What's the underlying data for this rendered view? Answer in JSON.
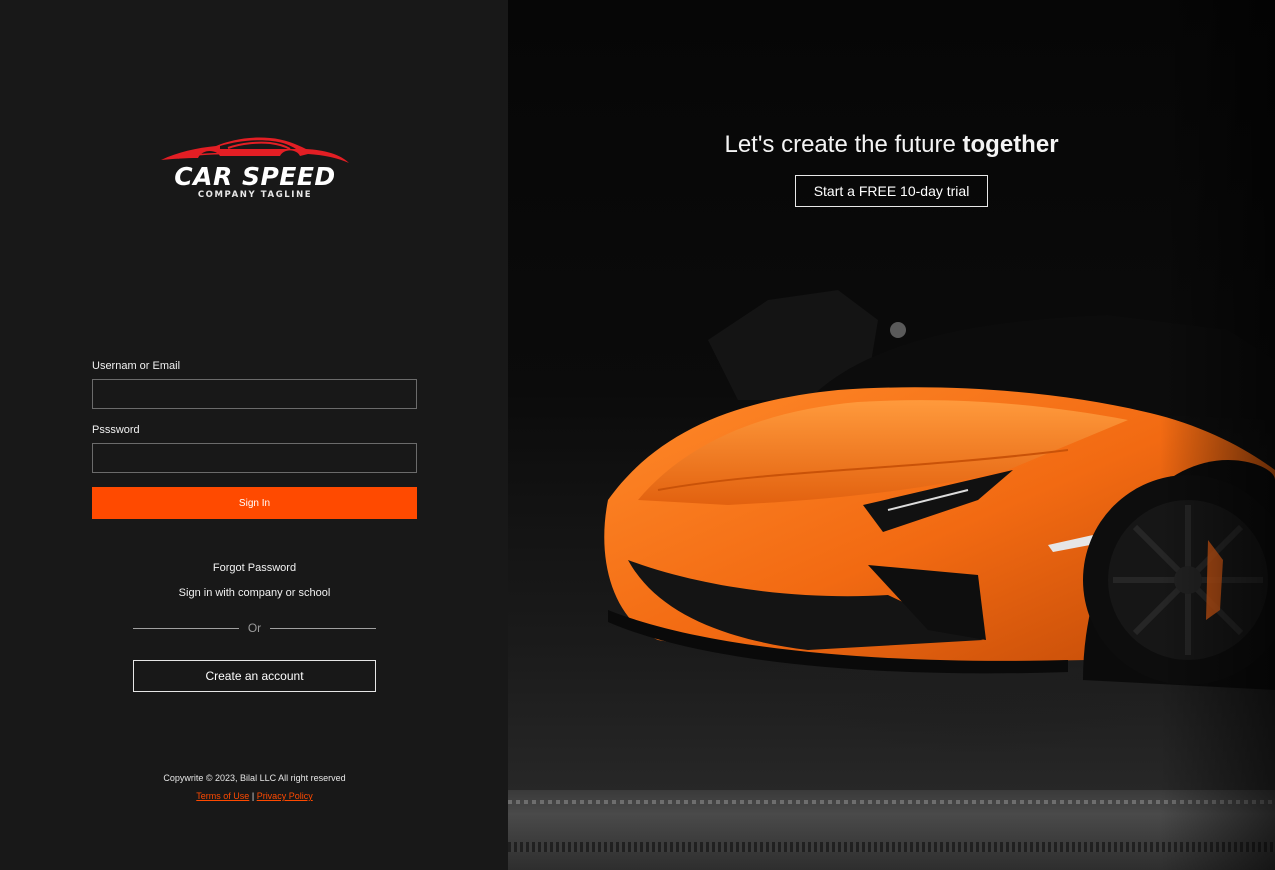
{
  "brand": {
    "name": "CAR SPEED",
    "tagline": "COMPANY TAGLINE",
    "accent_color": "#ff4a00",
    "logo_color": "#e31e24",
    "logo_icon": "car-silhouette-icon"
  },
  "login": {
    "username_label": "Usernam or Email",
    "username_value": "",
    "password_label": "Psssword",
    "password_value": "",
    "signin_label": "Sign In",
    "forgot_label": "Forgot Password",
    "sso_label": "Sign in with company or school",
    "divider_label": "Or",
    "create_label": "Create an account"
  },
  "footer": {
    "copyright": "Copywrite © 2023, Bilal LLC All right reserved",
    "terms_label": "Terms of Use",
    "separator": "|",
    "privacy_label": "Privacy Policy"
  },
  "hero": {
    "headline_regular": "Let's create the future ",
    "headline_bold": "together",
    "trial_label": "Start a FREE 10-day trial",
    "image_subject": "orange sports car in dark garage",
    "car_color": "#f26a12"
  }
}
